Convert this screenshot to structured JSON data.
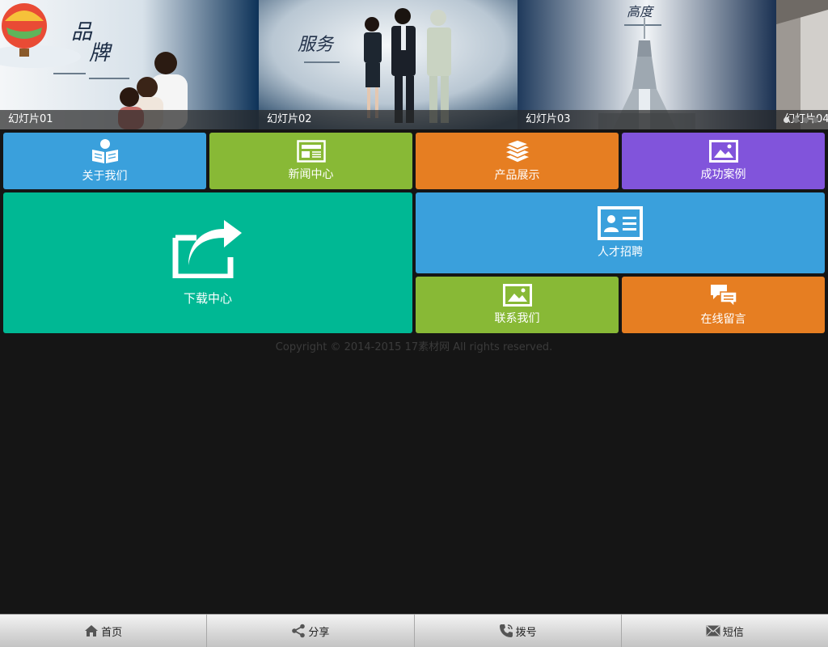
{
  "slider": {
    "slides": [
      {
        "caption": "幻灯片01",
        "title_art": "品牌",
        "art": "brand-family"
      },
      {
        "caption": "幻灯片02",
        "title_art": "服务",
        "art": "service-staff"
      },
      {
        "caption": "幻灯片03",
        "title_art": "高度",
        "art": "tower"
      },
      {
        "caption": "幻灯片04",
        "title_art": "",
        "art": "partial"
      }
    ],
    "dots": 4,
    "active_dot": 0
  },
  "tiles": {
    "about": {
      "label": "关于我们",
      "color": "#3aa0dc",
      "icon": "reader-icon"
    },
    "news": {
      "label": "新闻中心",
      "color": "#88b936",
      "icon": "newspaper-icon"
    },
    "products": {
      "label": "产品展示",
      "color": "#e67e22",
      "icon": "layers-icon"
    },
    "cases": {
      "label": "成功案例",
      "color": "#8154db",
      "icon": "image-icon"
    },
    "download": {
      "label": "下载中心",
      "color": "#00b894",
      "icon": "share-arrow-icon"
    },
    "jobs": {
      "label": "人才招聘",
      "color": "#3aa0dc",
      "icon": "id-card-icon"
    },
    "contact": {
      "label": "联系我们",
      "color": "#88b936",
      "icon": "image-icon"
    },
    "message": {
      "label": "在线留言",
      "color": "#e67e22",
      "icon": "chat-bubbles-icon"
    }
  },
  "footer": {
    "copyright": "Copyright © 2014-2015 17素材网 All rights reserved."
  },
  "bottom_bar": {
    "home": {
      "label": "首页",
      "icon": "home-icon"
    },
    "share": {
      "label": "分享",
      "icon": "share-icon"
    },
    "dial": {
      "label": "拨号",
      "icon": "phone-icon"
    },
    "sms": {
      "label": "短信",
      "icon": "envelope-icon"
    }
  }
}
